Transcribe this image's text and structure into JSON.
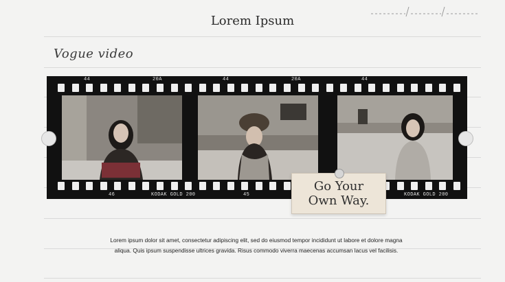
{
  "header": {
    "title": "Lorem Ipsum"
  },
  "section": {
    "script_heading": "Vogue video"
  },
  "film": {
    "top_labels": [
      "44",
      "20A",
      "44",
      "20A",
      "44"
    ],
    "bottom_labels": [
      "46",
      "KODAK GOLD 200",
      "45",
      "KODAK GOLD 200"
    ]
  },
  "note": {
    "line1": "Go Your",
    "line2": "Own Way."
  },
  "content": {
    "paragraph_line1": "Lorem ipsum dolor sit amet, consectetur adipiscing elit, sed do eiusmod tempor incididunt ut labore et dolore magna",
    "paragraph_line2": "aliqua. Quis ipsum suspendisse ultrices gravida. Risus commodo viverra maecenas accumsan lacus vel facilisis."
  },
  "colors": {
    "background": "#f3f3f2",
    "film": "#111111",
    "note": "#ede5d8"
  }
}
